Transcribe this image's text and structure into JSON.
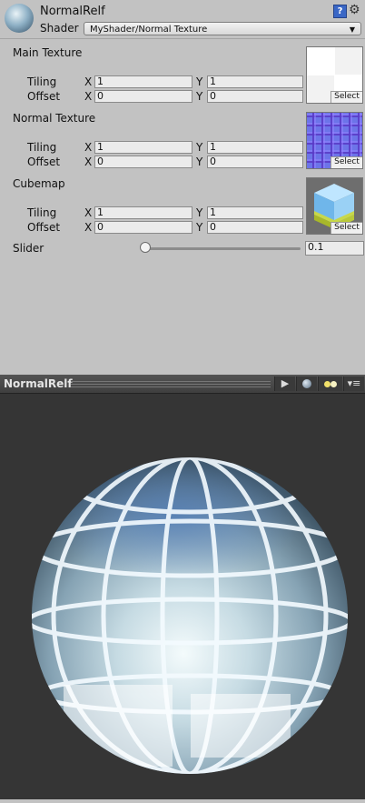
{
  "header": {
    "material_name": "NormalRelf",
    "shader_label": "Shader",
    "shader_value": "MyShader/Normal Texture",
    "help_icon": "help-book-icon",
    "settings_icon": "gear-icon"
  },
  "properties": [
    {
      "title": "Main Texture",
      "tiling_label": "Tiling",
      "offset_label": "Offset",
      "x_label": "X",
      "y_label": "Y",
      "tiling_x": "1",
      "tiling_y": "1",
      "offset_x": "0",
      "offset_y": "0",
      "select_label": "Select"
    },
    {
      "title": "Normal Texture",
      "tiling_label": "Tiling",
      "offset_label": "Offset",
      "x_label": "X",
      "y_label": "Y",
      "tiling_x": "1",
      "tiling_y": "1",
      "offset_x": "0",
      "offset_y": "0",
      "select_label": "Select"
    },
    {
      "title": "Cubemap",
      "tiling_label": "Tiling",
      "offset_label": "Offset",
      "x_label": "X",
      "y_label": "Y",
      "tiling_x": "1",
      "tiling_y": "1",
      "offset_x": "0",
      "offset_y": "0",
      "select_label": "Select"
    }
  ],
  "slider": {
    "label": "Slider",
    "value": "0.1",
    "fraction": 0.0
  },
  "preview": {
    "title": "NormalRelf",
    "play_icon": "play-icon",
    "sphere_icon": "sphere-icon",
    "light_icon": "light-toggle-icon",
    "menu_icon": "menu-icon"
  },
  "colors": {
    "inspector_bg": "#c2c2c2",
    "preview_bg": "#353535",
    "normal_map": "#6c74e8"
  }
}
